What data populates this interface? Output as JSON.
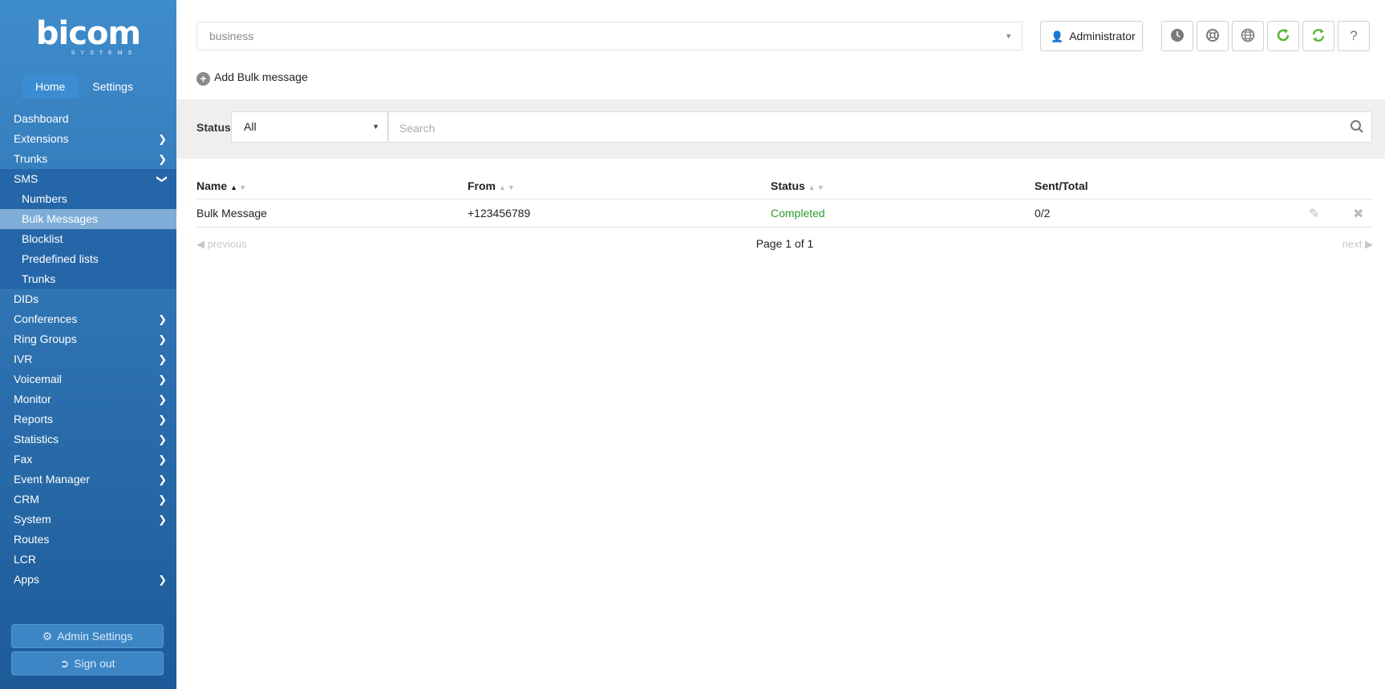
{
  "brand": {
    "name": "bicom",
    "sub": "SYSTEMS"
  },
  "sidebar": {
    "tabs": [
      {
        "label": "Home"
      },
      {
        "label": "Settings"
      }
    ],
    "items": [
      {
        "label": "Dashboard"
      },
      {
        "label": "Extensions"
      },
      {
        "label": "Trunks"
      },
      {
        "label": "SMS"
      },
      {
        "label": "Numbers"
      },
      {
        "label": "Bulk Messages"
      },
      {
        "label": "Blocklist"
      },
      {
        "label": "Predefined lists"
      },
      {
        "label": "Trunks"
      },
      {
        "label": "DIDs"
      },
      {
        "label": "Conferences"
      },
      {
        "label": "Ring Groups"
      },
      {
        "label": "IVR"
      },
      {
        "label": "Voicemail"
      },
      {
        "label": "Monitor"
      },
      {
        "label": "Reports"
      },
      {
        "label": "Statistics"
      },
      {
        "label": "Fax"
      },
      {
        "label": "Event Manager"
      },
      {
        "label": "CRM"
      },
      {
        "label": "System"
      },
      {
        "label": "Routes"
      },
      {
        "label": "LCR"
      },
      {
        "label": "Apps"
      }
    ],
    "admin_settings": "Admin Settings",
    "sign_out": "Sign out"
  },
  "header": {
    "domain_value": "business",
    "user_label": "Administrator",
    "help_label": "?"
  },
  "actions": {
    "add_bulk": "Add Bulk message"
  },
  "filter": {
    "status_label": "Status",
    "status_value": "All",
    "search_placeholder": "Search"
  },
  "table": {
    "columns": [
      "Name",
      "From",
      "Status",
      "Sent/Total"
    ],
    "rows": [
      {
        "name": "Bulk Message",
        "from": "+123456789",
        "status": "Completed",
        "sent_total": "0/2"
      }
    ]
  },
  "pager": {
    "previous": "previous",
    "page_info": "Page 1 of 1",
    "next": "next"
  },
  "colors": {
    "sidebar_top": "#3f8ccb",
    "sidebar_bottom": "#1d5a98",
    "selected_item": "#7eaed7",
    "status_completed": "#2c9a2c",
    "refresh_green": "#5bb533"
  }
}
